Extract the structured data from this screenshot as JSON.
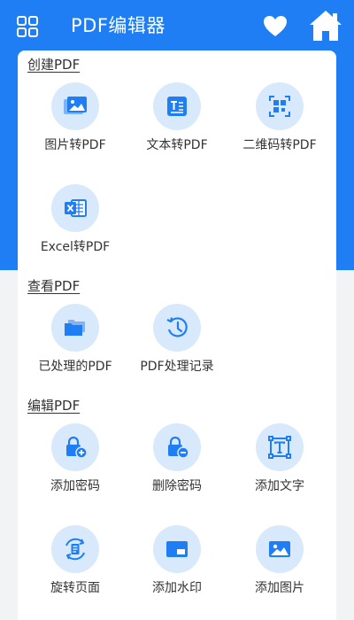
{
  "header": {
    "title": "PDF编辑器",
    "menu_icon": "grid-menu-icon",
    "favorite_icon": "heart-icon",
    "home_icon": "home-icon"
  },
  "sections": {
    "create": {
      "title": "创建PDF",
      "items": [
        {
          "label": "图片转PDF",
          "icon": "image-icon"
        },
        {
          "label": "文本转PDF",
          "icon": "text-document-icon"
        },
        {
          "label": "二维码转PDF",
          "icon": "qr-code-icon"
        },
        {
          "label": "Excel转PDF",
          "icon": "excel-icon"
        }
      ]
    },
    "view": {
      "title": "查看PDF",
      "items": [
        {
          "label": "已处理的PDF",
          "icon": "folders-icon"
        },
        {
          "label": "PDF处理记录",
          "icon": "history-clock-icon"
        }
      ]
    },
    "edit": {
      "title": "编辑PDF",
      "items": [
        {
          "label": "添加密码",
          "icon": "lock-add-icon"
        },
        {
          "label": "删除密码",
          "icon": "lock-remove-icon"
        },
        {
          "label": "添加文字",
          "icon": "add-text-icon"
        },
        {
          "label": "旋转页面",
          "icon": "rotate-page-icon"
        },
        {
          "label": "添加水印",
          "icon": "watermark-icon"
        },
        {
          "label": "添加图片",
          "icon": "add-image-icon"
        }
      ]
    }
  },
  "colors": {
    "primary": "#1f7ef4",
    "icon_bg": "#d8e9fb",
    "page_bg": "#f2f3f5",
    "card_bg": "#ffffff"
  }
}
